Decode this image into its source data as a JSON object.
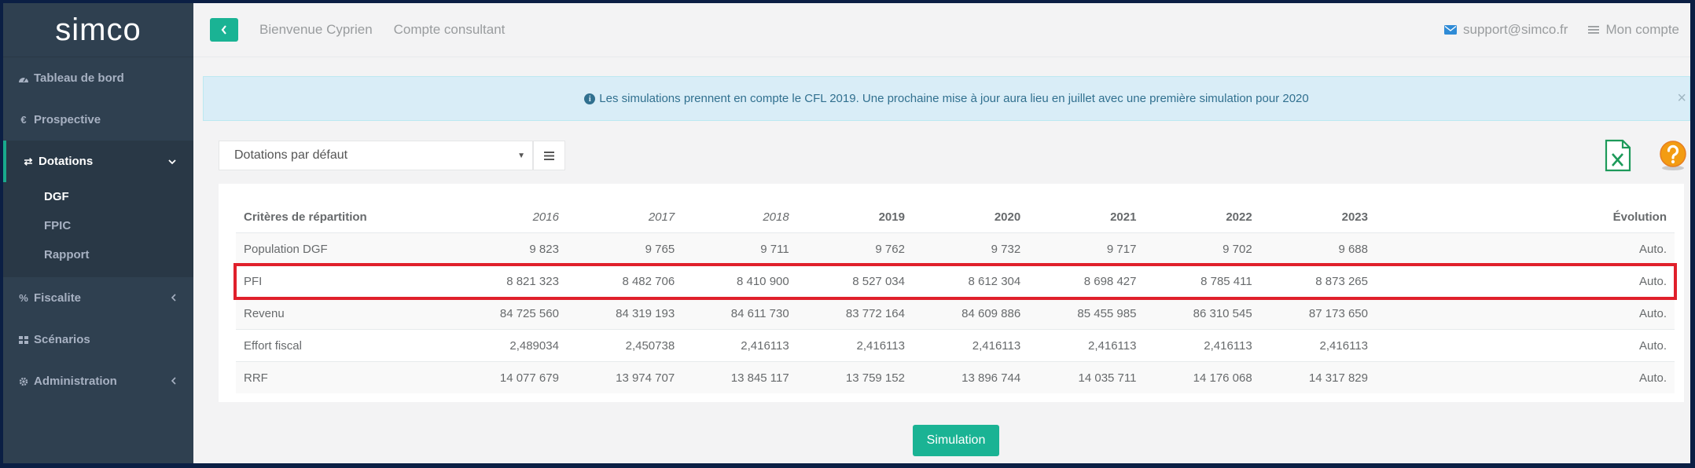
{
  "brand": "simco",
  "sidebar": {
    "items": [
      {
        "label": "Tableau de bord",
        "icon": "dashboard-icon"
      },
      {
        "label": "Prospective",
        "icon": "euro-icon"
      },
      {
        "label": "Dotations",
        "icon": "exchange-icon",
        "active": true,
        "sub": [
          "DGF",
          "FPIC",
          "Rapport"
        ]
      },
      {
        "label": "Fiscalite",
        "icon": "percent-icon"
      },
      {
        "label": "Scénarios",
        "icon": "grid-icon"
      },
      {
        "label": "Administration",
        "icon": "gear-icon"
      }
    ]
  },
  "header": {
    "welcome": "Bienvenue Cyprien",
    "account_type": "Compte consultant",
    "support_email": "support@simco.fr",
    "my_account": "Mon compte"
  },
  "alert": {
    "text": "Les simulations prennent en compte le CFL 2019. Une prochaine mise à jour aura lieu en juillet avec une première simulation pour 2020",
    "close": "×"
  },
  "controls": {
    "select_value": "Dotations par défaut"
  },
  "table": {
    "headers": [
      "Critères de répartition",
      "2016",
      "2017",
      "2018",
      "2019",
      "2020",
      "2021",
      "2022",
      "2023",
      "Évolution"
    ],
    "rows": [
      [
        "Population DGF",
        "9 823",
        "9 765",
        "9 711",
        "9 762",
        "9 732",
        "9 717",
        "9 702",
        "9 688",
        "Auto."
      ],
      [
        "PFI",
        "8 821 323",
        "8 482 706",
        "8 410 900",
        "8 527 034",
        "8 612 304",
        "8 698 427",
        "8 785 411",
        "8 873 265",
        "Auto."
      ],
      [
        "Revenu",
        "84 725 560",
        "84 319 193",
        "84 611 730",
        "83 772 164",
        "84 609 886",
        "85 455 985",
        "86 310 545",
        "87 173 650",
        "Auto."
      ],
      [
        "Effort fiscal",
        "2,489034",
        "2,450738",
        "2,416113",
        "2,416113",
        "2,416113",
        "2,416113",
        "2,416113",
        "2,416113",
        "Auto."
      ],
      [
        "RRF",
        "14 077 679",
        "13 974 707",
        "13 845 117",
        "13 759 152",
        "13 896 744",
        "14 035 711",
        "14 176 068",
        "14 317 829",
        "Auto."
      ]
    ]
  },
  "simulation_button": "Simulation",
  "colors": {
    "accent": "#1ab394",
    "sidebar": "#2f4050",
    "highlight": "#e0202b"
  }
}
